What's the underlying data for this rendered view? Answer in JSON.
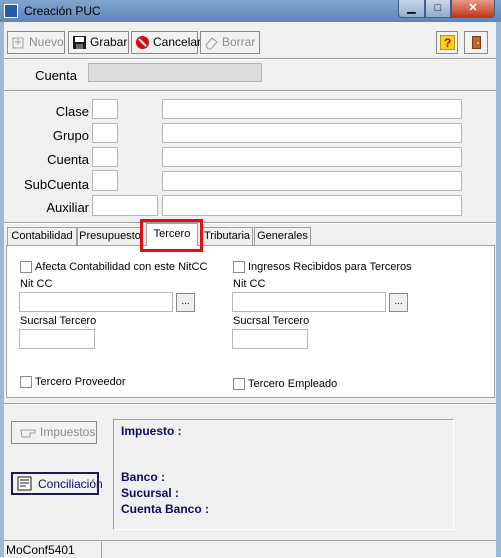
{
  "window": {
    "title": "Creación PUC"
  },
  "toolbar": {
    "nuevo": "Nuevo",
    "grabar": "Grabar",
    "cancelar": "Cancelar",
    "borrar": "Borrar",
    "help_icon": "help-icon",
    "exit_icon": "exit-door-icon"
  },
  "header": {
    "cuenta_label": "Cuenta",
    "cuenta_value": ""
  },
  "levels": [
    {
      "label": "Clase"
    },
    {
      "label": "Grupo"
    },
    {
      "label": "Cuenta"
    },
    {
      "label": "SubCuenta"
    },
    {
      "label": "Auxiliar"
    }
  ],
  "tabs": [
    "Contabilidad",
    "Presupuesto",
    "Tercero",
    "Tributaria",
    "Generales"
  ],
  "active_tab": "Tercero",
  "tercero": {
    "left": {
      "checkbox": "Afecta Contabilidad con este NitCC",
      "nit_label": "Nit CC",
      "sucursal_label": "Sucrsal Tercero",
      "bottom_checkbox": "Tercero Proveedor"
    },
    "right": {
      "checkbox": "Ingresos Recibidos para Terceros",
      "nit_label": "Nit CC",
      "sucursal_label": "Sucrsal Tercero",
      "bottom_checkbox": "Tercero Empleado"
    },
    "browse_label": "..."
  },
  "bottom": {
    "impuestos_button": "Impuestos",
    "conciliacion_button": "Conciliación",
    "impuesto_label": "Impuesto :",
    "banco_label": "Banco :",
    "sucursal_label": "Sucursal :",
    "cuenta_banco_label": "Cuenta Banco :"
  },
  "statusbar": {
    "text": "MoConf5401"
  },
  "colors": {
    "highlight": "#e0101a",
    "label_blue": "#0b0b6b"
  }
}
